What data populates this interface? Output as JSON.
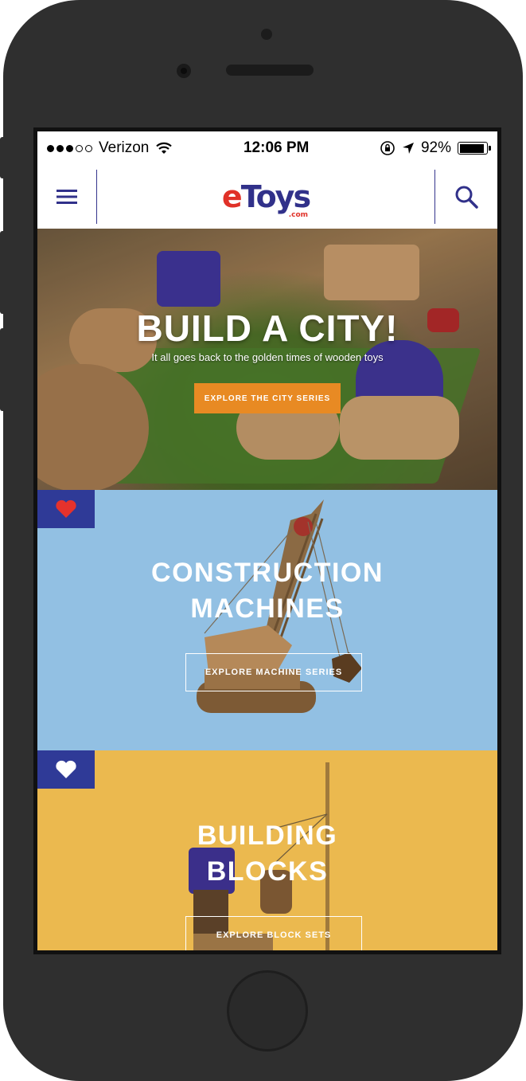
{
  "status_bar": {
    "carrier": "Verizon",
    "time": "12:06 PM",
    "battery": "92%",
    "battery_level": 0.92
  },
  "nav": {
    "logo_e": "e",
    "logo_toys": "Toys",
    "logo_com": ".com"
  },
  "hero": {
    "title": "BUILD A CITY!",
    "subtitle": "It all goes back to the golden times of wooden toys",
    "button": "EXPLORE THE CITY SERIES"
  },
  "panels": [
    {
      "title_line1": "CONSTRUCTION",
      "title_line2": "MACHINES",
      "button": "EXPLORE MACHINE SERIES",
      "favorited": true
    },
    {
      "title_line1": "BUILDING",
      "title_line2": "BLOCKS",
      "button": "EXPLORE BLOCK SETS",
      "favorited": false
    }
  ],
  "colors": {
    "brand_red": "#e03128",
    "brand_blue": "#31318a",
    "orange_button": "#e88a23",
    "panel_blue": "#92c0e3",
    "panel_yellow": "#ebb94f",
    "fav_bg": "#2f3a97"
  },
  "icons": [
    "menu-icon",
    "search-icon",
    "wifi-icon",
    "orientation-lock-icon",
    "location-icon",
    "battery-icon",
    "heart-icon"
  ]
}
